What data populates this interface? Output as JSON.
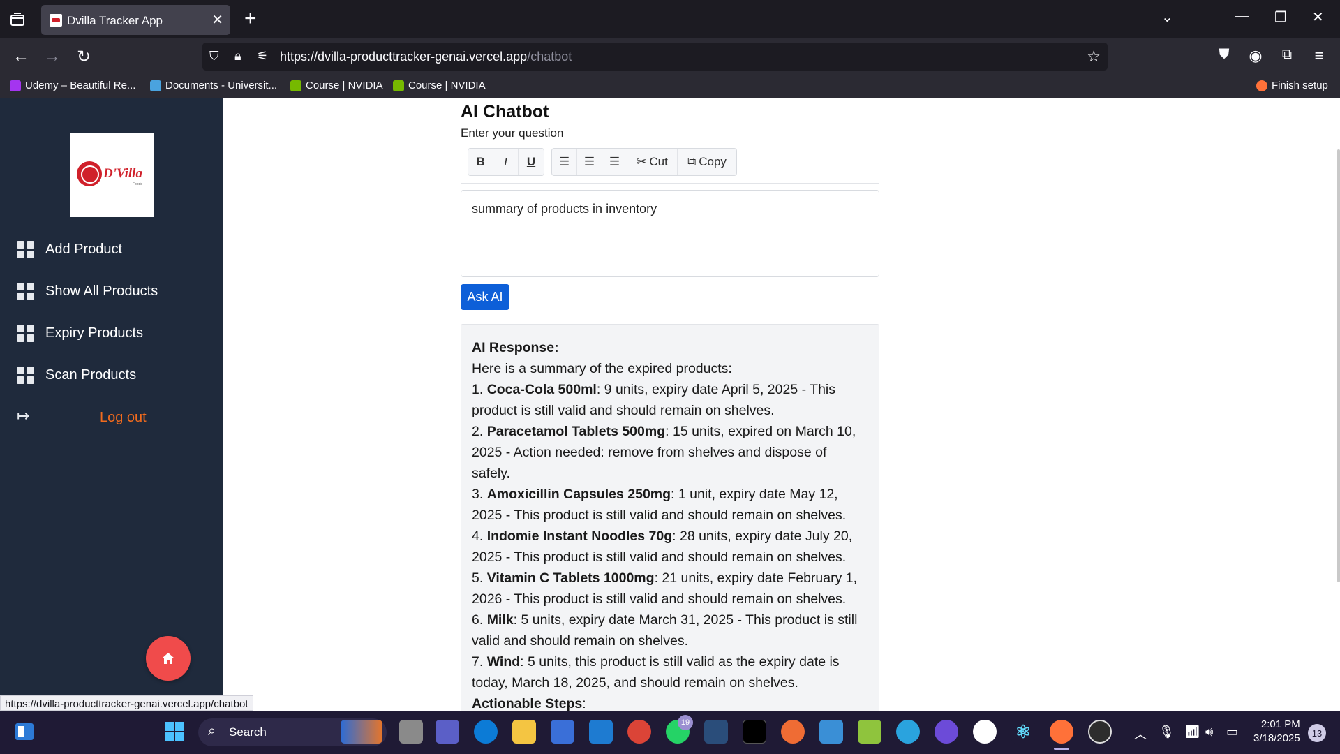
{
  "browser": {
    "tab_title": "Dvilla Tracker App",
    "tab_close": "✕",
    "new_tab": "+",
    "url_host": "https://dvilla-producttracker-genai.vercel.app",
    "url_path": "/chatbot",
    "bookmarks": [
      {
        "label": "Udemy – Beautiful Re...",
        "color": "#a435f0"
      },
      {
        "label": "Documents - Universit...",
        "color": "#4aa3df"
      },
      {
        "label": "Course | NVIDIA",
        "color": "#76b900"
      },
      {
        "label": "Course | NVIDIA",
        "color": "#76b900"
      }
    ],
    "finish_setup": "Finish setup",
    "status_url": "https://dvilla-producttracker-genai.vercel.app/chatbot"
  },
  "sidebar": {
    "logo_text": "D'Villa",
    "logo_sub": "Foods",
    "items": [
      {
        "label": "Add Product"
      },
      {
        "label": "Show All Products"
      },
      {
        "label": "Expiry Products"
      },
      {
        "label": "Scan Products"
      }
    ],
    "logout_label": "Log out"
  },
  "chat": {
    "title": "AI Chatbot",
    "question_label": "Enter your question",
    "toolbar": {
      "bold": "B",
      "italic": "I",
      "underline": "U",
      "cut": "Cut",
      "copy": "Copy"
    },
    "question": "summary of products in inventory",
    "ask_button": "Ask AI",
    "response": {
      "heading": "AI Response:",
      "intro": "Here is a summary of the expired products:",
      "items": [
        {
          "num": "1. ",
          "name": "Coca-Cola 500ml",
          "detail": ": 9 units, expiry date April 5, 2025 - This product is still valid and should remain on shelves."
        },
        {
          "num": "2. ",
          "name": "Paracetamol Tablets 500mg",
          "detail": ": 15 units, expired on March 10, 2025 - Action needed: remove from shelves and dispose of safely."
        },
        {
          "num": "3. ",
          "name": "Amoxicillin Capsules 250mg",
          "detail": ": 1 unit, expiry date May 12, 2025 - This product is still valid and should remain on shelves."
        },
        {
          "num": "4. ",
          "name": "Indomie Instant Noodles 70g",
          "detail": ": 28 units, expiry date July 20, 2025 - This product is still valid and should remain on shelves."
        },
        {
          "num": "5. ",
          "name": "Vitamin C Tablets 1000mg",
          "detail": ": 21 units, expiry date February 1, 2026 - This product is still valid and should remain on shelves."
        },
        {
          "num": "6. ",
          "name": "Milk",
          "detail": ": 5 units, expiry date March 31, 2025 - This product is still valid and should remain on shelves."
        },
        {
          "num": "7. ",
          "name": "Wind",
          "detail": ": 5 units, this product is still valid as the expiry date is today, March 18, 2025, and should remain on shelves."
        }
      ],
      "steps_heading": "Actionable Steps",
      "steps_colon": ":"
    }
  },
  "taskbar": {
    "search_label": "Search",
    "whatsapp_badge": "19",
    "time": "2:01 PM",
    "date": "3/18/2025",
    "notifications": "13"
  }
}
